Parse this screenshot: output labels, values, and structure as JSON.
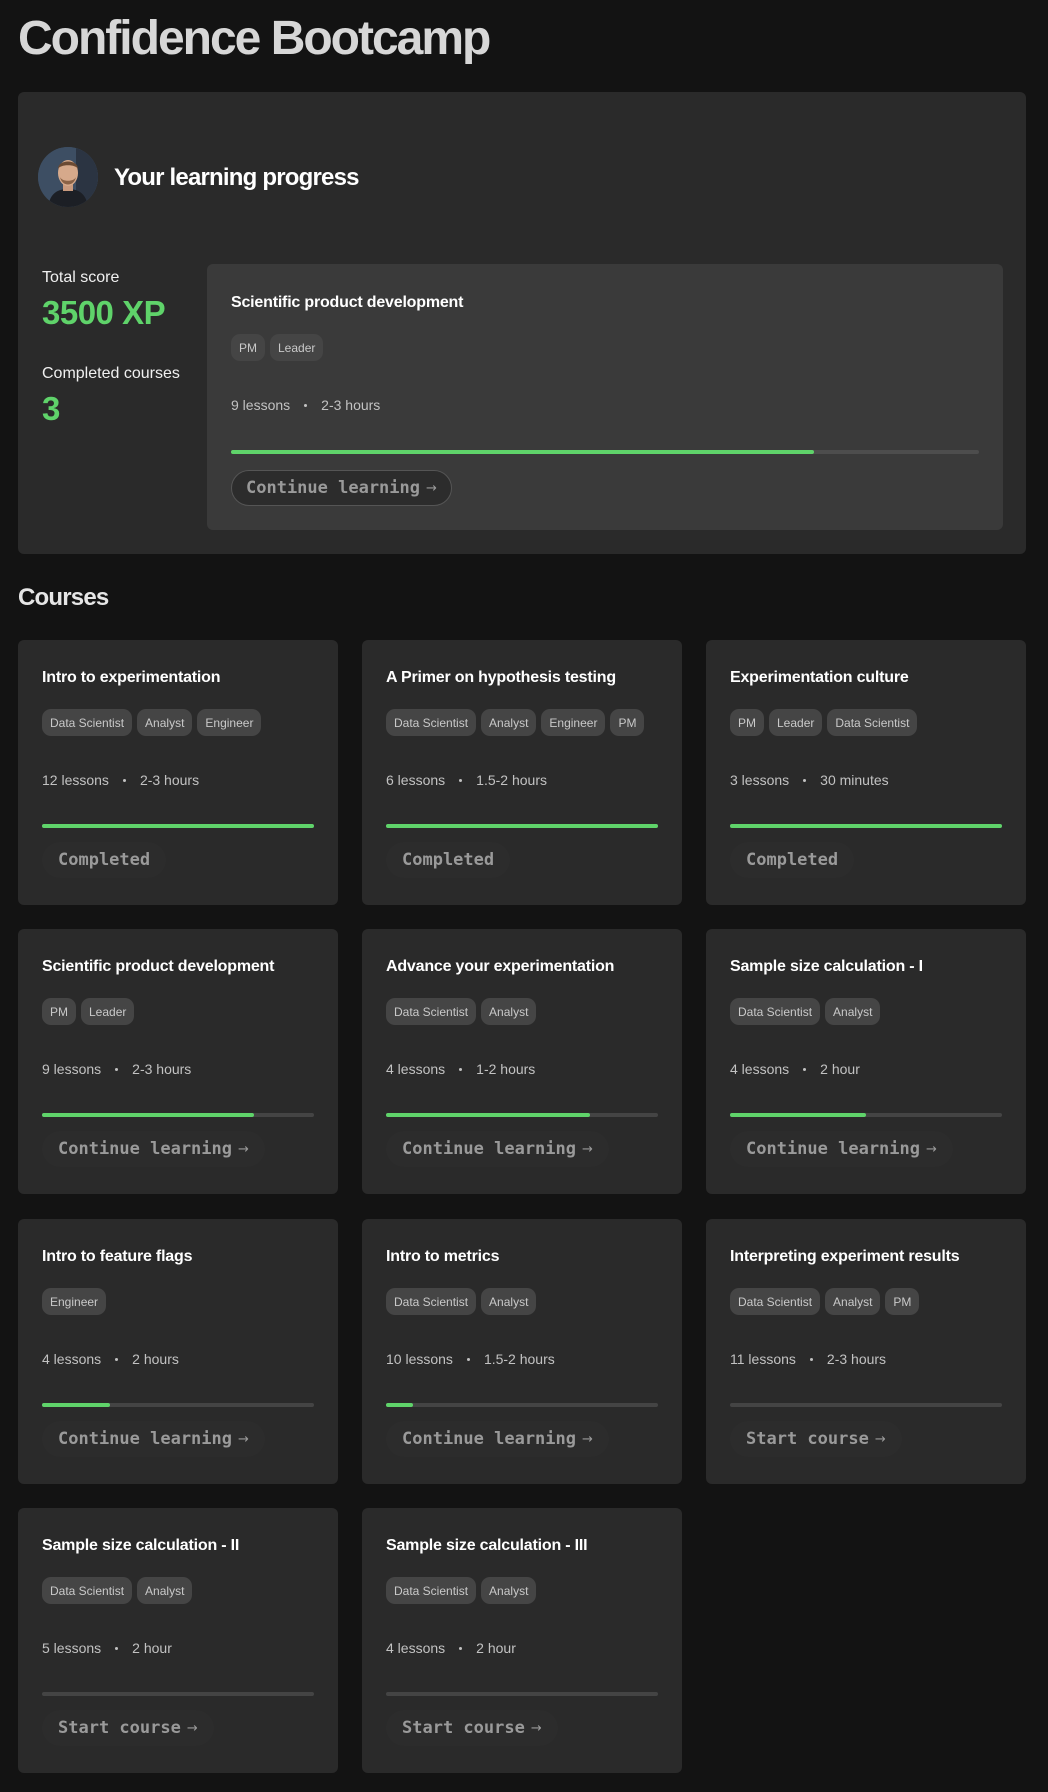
{
  "page": {
    "title": "Confidence Bootcamp"
  },
  "progress": {
    "heading": "Your learning progress",
    "total_score_label": "Total score",
    "total_score_value": "3500 XP",
    "completed_label": "Completed courses",
    "completed_value": "3",
    "current_course": {
      "title": "Scientific product development",
      "tags": [
        "PM",
        "Leader"
      ],
      "lessons": "9 lessons",
      "duration": "2-3 hours",
      "progress_pct": 78,
      "cta": "Continue learning",
      "cta_icon": "arrow-right-icon"
    }
  },
  "courses": {
    "heading": "Courses",
    "items": [
      {
        "title": "Intro to experimentation",
        "tags": [
          "Data Scientist",
          "Analyst",
          "Engineer"
        ],
        "lessons": "12 lessons",
        "duration": "2-3 hours",
        "progress_pct": 100,
        "cta": "Completed",
        "arrow": false
      },
      {
        "title": "A Primer on hypothesis testing",
        "tags": [
          "Data Scientist",
          "Analyst",
          "Engineer",
          "PM"
        ],
        "lessons": "6 lessons",
        "duration": "1.5-2 hours",
        "progress_pct": 100,
        "cta": "Completed",
        "arrow": false
      },
      {
        "title": "Experimentation culture",
        "tags": [
          "PM",
          "Leader",
          "Data Scientist"
        ],
        "lessons": "3 lessons",
        "duration": "30 minutes",
        "progress_pct": 100,
        "cta": "Completed",
        "arrow": false
      },
      {
        "title": "Scientific product development",
        "tags": [
          "PM",
          "Leader"
        ],
        "lessons": "9 lessons",
        "duration": "2-3 hours",
        "progress_pct": 78,
        "cta": "Continue learning",
        "arrow": true
      },
      {
        "title": "Advance your experimentation",
        "tags": [
          "Data Scientist",
          "Analyst"
        ],
        "lessons": "4 lessons",
        "duration": "1-2 hours",
        "progress_pct": 75,
        "cta": "Continue learning",
        "arrow": true
      },
      {
        "title": "Sample size calculation - I",
        "tags": [
          "Data Scientist",
          "Analyst"
        ],
        "lessons": "4 lessons",
        "duration": "2 hour",
        "progress_pct": 50,
        "cta": "Continue learning",
        "arrow": true
      },
      {
        "title": "Intro to feature flags",
        "tags": [
          "Engineer"
        ],
        "lessons": "4 lessons",
        "duration": "2 hours",
        "progress_pct": 25,
        "cta": "Continue learning",
        "arrow": true
      },
      {
        "title": "Intro to metrics",
        "tags": [
          "Data Scientist",
          "Analyst"
        ],
        "lessons": "10 lessons",
        "duration": "1.5-2 hours",
        "progress_pct": 10,
        "cta": "Continue learning",
        "arrow": true
      },
      {
        "title": "Interpreting experiment results",
        "tags": [
          "Data Scientist",
          "Analyst",
          "PM"
        ],
        "lessons": "11 lessons",
        "duration": "2-3 hours",
        "progress_pct": 0,
        "cta": "Start course",
        "arrow": true
      },
      {
        "title": "Sample size calculation - II",
        "tags": [
          "Data Scientist",
          "Analyst"
        ],
        "lessons": "5 lessons",
        "duration": "2 hour",
        "progress_pct": 0,
        "cta": "Start course",
        "arrow": true
      },
      {
        "title": "Sample size calculation - III",
        "tags": [
          "Data Scientist",
          "Analyst"
        ],
        "lessons": "4 lessons",
        "duration": "2 hour",
        "progress_pct": 0,
        "cta": "Start course",
        "arrow": true
      }
    ]
  },
  "colors": {
    "accent": "#5fd36a",
    "background": "#131313",
    "card": "#2a2a2a",
    "tag": "#454545"
  },
  "icons": {
    "avatar": "user-avatar-photo",
    "arrow": "arrow-right-icon"
  }
}
